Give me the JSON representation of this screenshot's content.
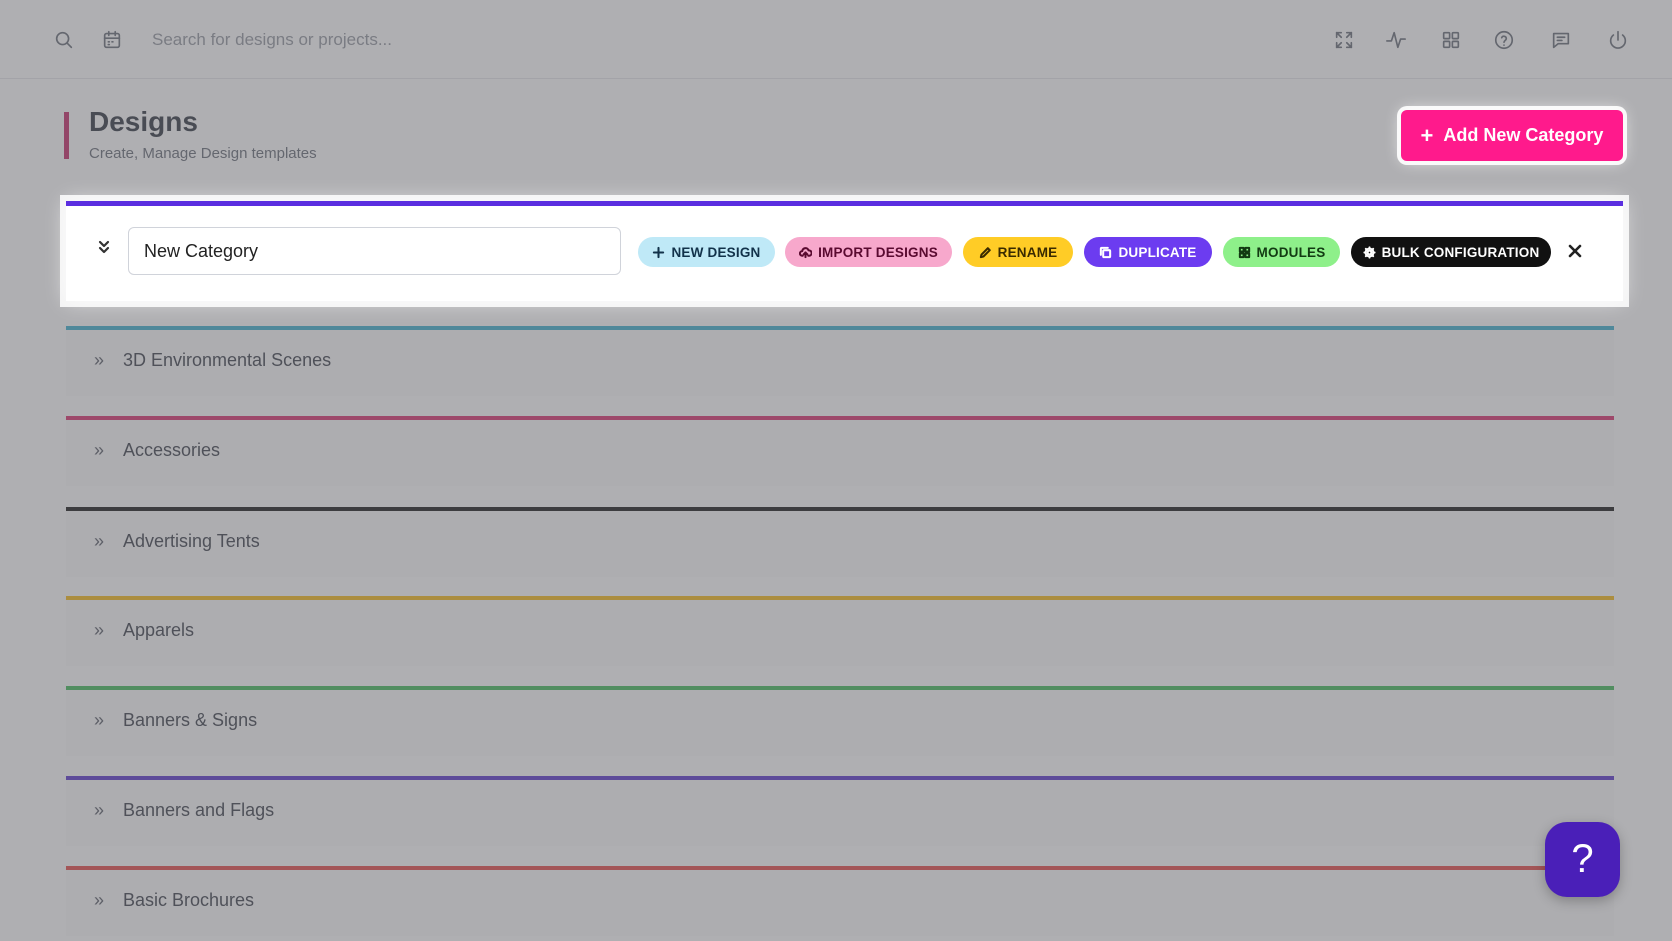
{
  "header": {
    "search_placeholder": "Search for designs or projects...",
    "icons": [
      "search-icon",
      "calendar-icon",
      "fullscreen-icon",
      "activity-icon",
      "grid-icon",
      "help-circle-icon",
      "chat-icon",
      "power-icon"
    ]
  },
  "page": {
    "title": "Designs",
    "subtitle": "Create, Manage Design templates",
    "add_button_label": "Add New Category"
  },
  "editing_category": {
    "name_value": "New Category",
    "accent": "#5b2ee0",
    "actions": [
      {
        "label": "NEW DESIGN",
        "bg": "#bfe9f7",
        "fg": "#12324a"
      },
      {
        "label": "IMPORT DESIGNS",
        "bg": "#f7a8cc",
        "fg": "#5a0a30"
      },
      {
        "label": "RENAME",
        "bg": "#ffcc26",
        "fg": "#3a2a00"
      },
      {
        "label": "DUPLICATE",
        "bg": "#6c3cf0",
        "fg": "#ffffff"
      },
      {
        "label": "MODULES",
        "bg": "#8ef08a",
        "fg": "#123a12"
      },
      {
        "label": "BULK CONFIGURATION",
        "bg": "#111111",
        "fg": "#ffffff"
      }
    ]
  },
  "categories": [
    {
      "label": "3D Environmental Scenes",
      "accent": "#2aa9c9"
    },
    {
      "label": "Accessories",
      "accent": "#d81b60"
    },
    {
      "label": "Advertising Tents",
      "accent": "#000000"
    },
    {
      "label": "Apparels",
      "accent": "#f5b301"
    },
    {
      "label": "Banners & Signs",
      "accent": "#2fb44a"
    },
    {
      "label": "Banners and Flags",
      "accent": "#4a22c8"
    },
    {
      "label": "Basic Brochures",
      "accent": "#e53935"
    }
  ],
  "help_fab_label": "?"
}
